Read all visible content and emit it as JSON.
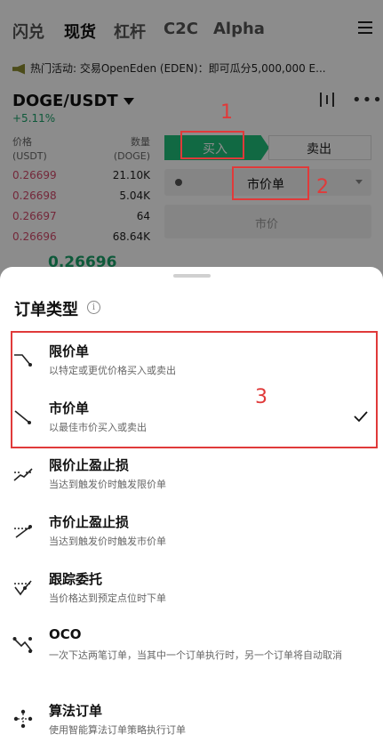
{
  "nav": {
    "tabs": [
      "闪兑",
      "现货",
      "杠杆",
      "C2C",
      "Alpha"
    ],
    "active": "现货"
  },
  "announcement": "热门活动: 交易OpenEden (EDEN)：即可瓜分5,000,000 E...",
  "pair": {
    "symbol": "DOGE/USDT",
    "change": "+5.11%"
  },
  "orderbook": {
    "price_header": "价格",
    "price_unit": "(USDT)",
    "qty_header": "数量",
    "qty_unit": "(DOGE)",
    "rows": [
      {
        "price": "0.26699",
        "qty": "21.10K"
      },
      {
        "price": "0.26698",
        "qty": "5.04K"
      },
      {
        "price": "0.26697",
        "qty": "64"
      },
      {
        "price": "0.26696",
        "qty": "68.64K"
      }
    ],
    "last_price": "0.26696"
  },
  "trade": {
    "buy_label": "买入",
    "sell_label": "卖出",
    "order_type_label": "市价单",
    "price_label": "市价"
  },
  "annotations": {
    "n1": "1",
    "n2": "2",
    "n3": "3"
  },
  "sheet": {
    "title": "订单类型",
    "info": "i",
    "options": [
      {
        "title": "限价单",
        "desc": "以特定或更优价格买入或卖出"
      },
      {
        "title": "市价单",
        "desc": "以最佳市价买入或卖出",
        "selected": true
      },
      {
        "title": "限价止盈止损",
        "desc": "当达到触发价时触发限价单"
      },
      {
        "title": "市价止盈止损",
        "desc": "当达到触发价时触发市价单"
      },
      {
        "title": "跟踪委托",
        "desc": "当价格达到预定点位时下单"
      },
      {
        "title": "OCO",
        "desc": "一次下达两笔订单，当其中一个订单执行时，另一个订单将自动取消"
      },
      {
        "title": "算法订单",
        "desc": "使用智能算法订单策略执行订单"
      }
    ]
  },
  "colors": {
    "buy": "#20c07a",
    "ask": "#d34a6b",
    "annotation": "#e03a3a"
  }
}
